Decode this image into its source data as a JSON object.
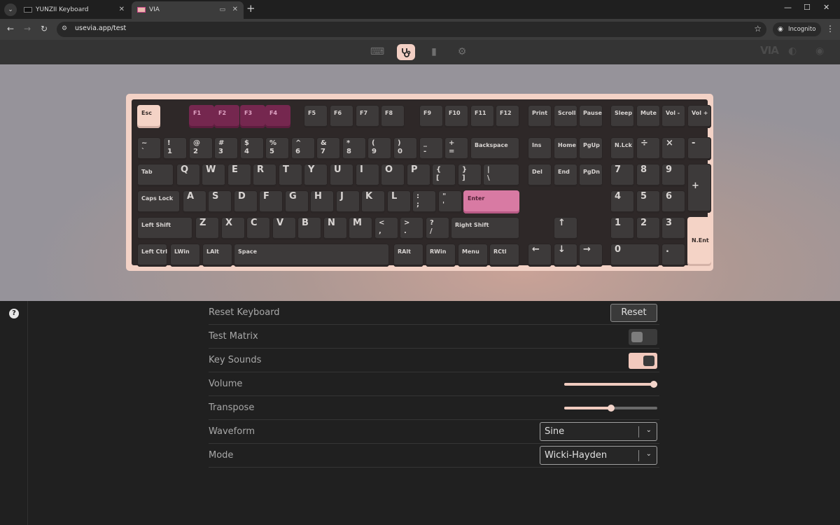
{
  "browser": {
    "tabs": [
      {
        "title": "YUNZII Keyboard",
        "active": false
      },
      {
        "title": "VIA",
        "active": true
      }
    ],
    "url": "usevia.app/test",
    "incognito_label": "Incognito"
  },
  "via": {
    "nav_icons": [
      "keyboard-icon",
      "stethoscope-icon",
      "design-icon",
      "settings-icon"
    ],
    "active_nav": "stethoscope-icon",
    "brand": "VIA"
  },
  "keyboard": {
    "accent_colors": {
      "case": "#f3d2c6",
      "magenta": "#75274f",
      "pink": "#d87aa3"
    },
    "keys": [
      {
        "id": "esc",
        "label": "Esc",
        "style": "cream"
      },
      {
        "id": "f1",
        "label": "F1",
        "style": "magenta"
      },
      {
        "id": "f2",
        "label": "F2",
        "style": "magenta"
      },
      {
        "id": "f3",
        "label": "F3",
        "style": "magenta"
      },
      {
        "id": "f4",
        "label": "F4",
        "style": "magenta"
      },
      {
        "id": "f5",
        "label": "F5"
      },
      {
        "id": "f6",
        "label": "F6"
      },
      {
        "id": "f7",
        "label": "F7"
      },
      {
        "id": "f8",
        "label": "F8"
      },
      {
        "id": "f9",
        "label": "F9"
      },
      {
        "id": "f10",
        "label": "F10"
      },
      {
        "id": "f11",
        "label": "F11"
      },
      {
        "id": "f12",
        "label": "F12"
      },
      {
        "id": "print",
        "label": "Print"
      },
      {
        "id": "scroll",
        "label": "Scroll"
      },
      {
        "id": "pause",
        "label": "Pause"
      },
      {
        "id": "sleep",
        "label": "Sleep"
      },
      {
        "id": "mute",
        "label": "Mute"
      },
      {
        "id": "vol-down",
        "label": "Vol -"
      },
      {
        "id": "vol-up",
        "label": "Vol +"
      },
      {
        "id": "grave",
        "label": "~\n`",
        "type": "dual"
      },
      {
        "id": "1",
        "label": "!\n1",
        "type": "dual"
      },
      {
        "id": "2",
        "label": "@\n2",
        "type": "dual"
      },
      {
        "id": "3",
        "label": "#\n3",
        "type": "dual"
      },
      {
        "id": "4",
        "label": "$\n4",
        "type": "dual"
      },
      {
        "id": "5",
        "label": "%\n5",
        "type": "dual"
      },
      {
        "id": "6",
        "label": "^\n6",
        "type": "dual"
      },
      {
        "id": "7",
        "label": "&\n7",
        "type": "dual"
      },
      {
        "id": "8",
        "label": "*\n8",
        "type": "dual"
      },
      {
        "id": "9",
        "label": "(\n9",
        "type": "dual"
      },
      {
        "id": "0",
        "label": ")\n0",
        "type": "dual"
      },
      {
        "id": "minus",
        "label": "_\n-",
        "type": "dual"
      },
      {
        "id": "equal",
        "label": "+\n=",
        "type": "dual"
      },
      {
        "id": "backspace",
        "label": "Backspace"
      },
      {
        "id": "ins",
        "label": "Ins"
      },
      {
        "id": "home",
        "label": "Home"
      },
      {
        "id": "pgup",
        "label": "PgUp"
      },
      {
        "id": "nlck",
        "label": "N.Lck"
      },
      {
        "id": "divide",
        "label": "÷",
        "type": "letter"
      },
      {
        "id": "multiply",
        "label": "×",
        "type": "letter"
      },
      {
        "id": "num-minus",
        "label": "-",
        "type": "letter"
      },
      {
        "id": "tab",
        "label": "Tab"
      },
      {
        "id": "q",
        "label": "Q",
        "type": "letter"
      },
      {
        "id": "w",
        "label": "W",
        "type": "letter"
      },
      {
        "id": "e",
        "label": "E",
        "type": "letter"
      },
      {
        "id": "r",
        "label": "R",
        "type": "letter"
      },
      {
        "id": "t",
        "label": "T",
        "type": "letter"
      },
      {
        "id": "y",
        "label": "Y",
        "type": "letter"
      },
      {
        "id": "u",
        "label": "U",
        "type": "letter"
      },
      {
        "id": "i",
        "label": "I",
        "type": "letter"
      },
      {
        "id": "o",
        "label": "O",
        "type": "letter"
      },
      {
        "id": "p",
        "label": "P",
        "type": "letter"
      },
      {
        "id": "lbracket",
        "label": "{\n[",
        "type": "dual"
      },
      {
        "id": "rbracket",
        "label": "}\n]",
        "type": "dual"
      },
      {
        "id": "backslash",
        "label": "|\n\\",
        "type": "dual"
      },
      {
        "id": "del",
        "label": "Del"
      },
      {
        "id": "end",
        "label": "End"
      },
      {
        "id": "pgdn",
        "label": "PgDn"
      },
      {
        "id": "num7",
        "label": "7",
        "type": "letter"
      },
      {
        "id": "num8",
        "label": "8",
        "type": "letter"
      },
      {
        "id": "num9",
        "label": "9",
        "type": "letter"
      },
      {
        "id": "num-plus",
        "label": "+",
        "type": "letter"
      },
      {
        "id": "caps",
        "label": "Caps Lock"
      },
      {
        "id": "a",
        "label": "A",
        "type": "letter"
      },
      {
        "id": "s",
        "label": "S",
        "type": "letter"
      },
      {
        "id": "d",
        "label": "D",
        "type": "letter"
      },
      {
        "id": "f",
        "label": "F",
        "type": "letter"
      },
      {
        "id": "g",
        "label": "G",
        "type": "letter"
      },
      {
        "id": "h",
        "label": "H",
        "type": "letter"
      },
      {
        "id": "j",
        "label": "J",
        "type": "letter"
      },
      {
        "id": "k",
        "label": "K",
        "type": "letter"
      },
      {
        "id": "l",
        "label": "L",
        "type": "letter"
      },
      {
        "id": "semicolon",
        "label": ":\n;",
        "type": "dual"
      },
      {
        "id": "quote",
        "label": "\"\n'",
        "type": "dual"
      },
      {
        "id": "enter",
        "label": "Enter",
        "style": "pink"
      },
      {
        "id": "num4",
        "label": "4",
        "type": "letter"
      },
      {
        "id": "num5",
        "label": "5",
        "type": "letter"
      },
      {
        "id": "num6",
        "label": "6",
        "type": "letter"
      },
      {
        "id": "lshift",
        "label": "Left Shift"
      },
      {
        "id": "z",
        "label": "Z",
        "type": "letter"
      },
      {
        "id": "x",
        "label": "X",
        "type": "letter"
      },
      {
        "id": "c",
        "label": "C",
        "type": "letter"
      },
      {
        "id": "v",
        "label": "V",
        "type": "letter"
      },
      {
        "id": "b",
        "label": "B",
        "type": "letter"
      },
      {
        "id": "n",
        "label": "N",
        "type": "letter"
      },
      {
        "id": "m",
        "label": "M",
        "type": "letter"
      },
      {
        "id": "comma",
        "label": "<\n,",
        "type": "dual"
      },
      {
        "id": "period",
        "label": ">\n.",
        "type": "dual"
      },
      {
        "id": "slash",
        "label": "?\n/",
        "type": "dual"
      },
      {
        "id": "rshift",
        "label": "Right Shift"
      },
      {
        "id": "up",
        "label": "↑",
        "type": "letter"
      },
      {
        "id": "num1",
        "label": "1",
        "type": "letter"
      },
      {
        "id": "num2",
        "label": "2",
        "type": "letter"
      },
      {
        "id": "num3",
        "label": "3",
        "type": "letter"
      },
      {
        "id": "nent",
        "label": "N.Ent",
        "style": "cream"
      },
      {
        "id": "lctrl",
        "label": "Left Ctrl"
      },
      {
        "id": "lwin",
        "label": "LWin"
      },
      {
        "id": "lalt",
        "label": "LAlt"
      },
      {
        "id": "space",
        "label": "Space"
      },
      {
        "id": "ralt",
        "label": "RAlt"
      },
      {
        "id": "rwin",
        "label": "RWin"
      },
      {
        "id": "menu",
        "label": "Menu"
      },
      {
        "id": "rctl",
        "label": "RCtl"
      },
      {
        "id": "left",
        "label": "←",
        "type": "letter"
      },
      {
        "id": "down",
        "label": "↓",
        "type": "letter"
      },
      {
        "id": "right",
        "label": "→",
        "type": "letter"
      },
      {
        "id": "num0",
        "label": "0",
        "type": "letter"
      },
      {
        "id": "num-dot",
        "label": ".",
        "type": "letter"
      }
    ]
  },
  "settings": {
    "reset_keyboard": {
      "label": "Reset Keyboard",
      "button": "Reset"
    },
    "test_matrix": {
      "label": "Test Matrix",
      "enabled": false
    },
    "key_sounds": {
      "label": "Key Sounds",
      "enabled": true
    },
    "volume": {
      "label": "Volume",
      "value": 1.0
    },
    "transpose": {
      "label": "Transpose",
      "value": 0.5
    },
    "waveform": {
      "label": "Waveform",
      "selected": "Sine"
    },
    "mode": {
      "label": "Mode",
      "selected": "Wicki-Hayden"
    }
  }
}
